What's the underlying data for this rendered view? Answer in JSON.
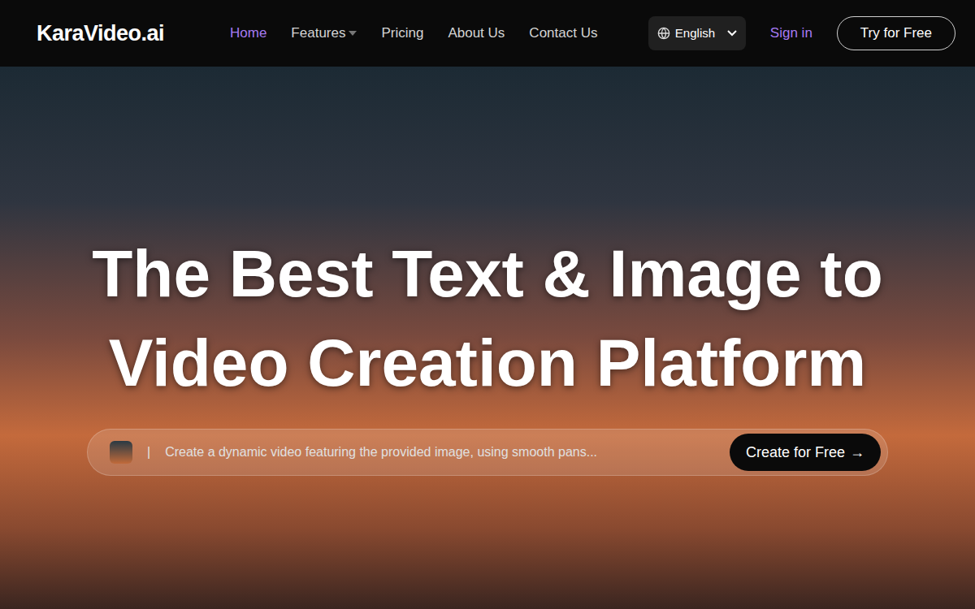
{
  "header": {
    "logo": "KaraVideo.ai",
    "nav": [
      {
        "label": "Home",
        "selected": true,
        "dropdown": false
      },
      {
        "label": "Features",
        "selected": false,
        "dropdown": true
      },
      {
        "label": "Pricing",
        "selected": false,
        "dropdown": false
      },
      {
        "label": "About Us",
        "selected": false,
        "dropdown": false
      },
      {
        "label": "Contact Us",
        "selected": false,
        "dropdown": false
      }
    ],
    "language": "English",
    "sign_in": "Sign in",
    "cta": "Try for Free"
  },
  "hero": {
    "title": "The Best Text & Image to Video Creation Platform",
    "prompt": {
      "separator": "|",
      "placeholder": "Create a dynamic video featuring the provided image, using smooth pans...",
      "button": "Create for Free",
      "button_arrow": "→"
    }
  }
}
